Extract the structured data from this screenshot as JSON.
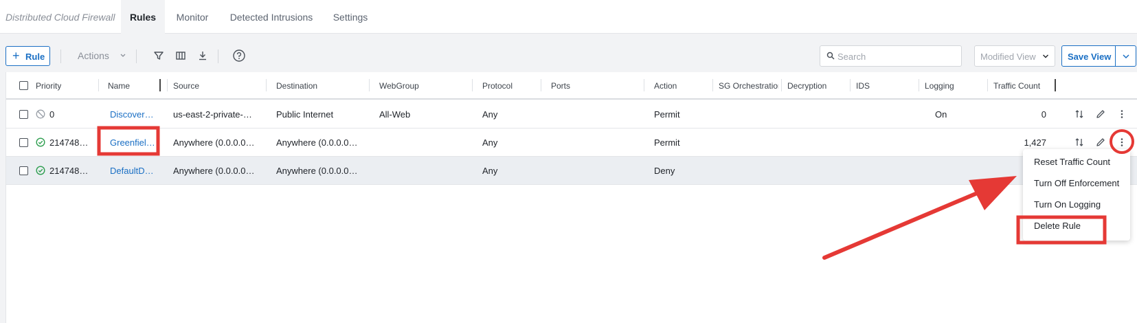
{
  "app": {
    "title": "Distributed Cloud Firewall"
  },
  "tabs": [
    {
      "label": "Rules",
      "active": true
    },
    {
      "label": "Monitor",
      "active": false
    },
    {
      "label": "Detected Intrusions",
      "active": false
    },
    {
      "label": "Settings",
      "active": false
    }
  ],
  "toolbar": {
    "rule_button": "Rule",
    "actions_label": "Actions",
    "search_placeholder": "Search",
    "view_select": "Modified View",
    "save_view": "Save View",
    "icons": [
      "filter-icon",
      "columns-icon",
      "download-icon",
      "help-icon"
    ]
  },
  "table": {
    "columns": [
      "Priority",
      "Name",
      "Source",
      "Destination",
      "WebGroup",
      "Protocol",
      "Ports",
      "Action",
      "SG Orchestration",
      "Decryption",
      "IDS",
      "Logging",
      "Traffic Count"
    ],
    "rows": [
      {
        "status": "disabled",
        "priority": "0",
        "name": "Discover…",
        "source": "us-east-2-private-…",
        "destination": "Public Internet",
        "webgroup": "All-Web",
        "protocol": "Any",
        "ports": "",
        "action": "Permit",
        "logging": "On",
        "traffic": "0"
      },
      {
        "status": "enabled",
        "priority": "214748…",
        "name": "Greenfiel…",
        "source": "Anywhere (0.0.0.0…",
        "destination": "Anywhere (0.0.0.0…",
        "webgroup": "",
        "protocol": "Any",
        "ports": "",
        "action": "Permit",
        "logging": "",
        "traffic": "1,427"
      },
      {
        "status": "enabled",
        "priority": "214748…",
        "name": "DefaultD…",
        "source": "Anywhere (0.0.0.0…",
        "destination": "Anywhere (0.0.0.0…",
        "webgroup": "",
        "protocol": "Any",
        "ports": "",
        "action": "Deny",
        "logging": "",
        "traffic": ""
      }
    ]
  },
  "context_menu": {
    "items": [
      "Reset Traffic Count",
      "Turn Off Enforcement",
      "Turn On Logging",
      "Delete Rule"
    ]
  },
  "colors": {
    "accent": "#1a6fc4",
    "success": "#2e9e4f",
    "annotation": "#e53935"
  }
}
